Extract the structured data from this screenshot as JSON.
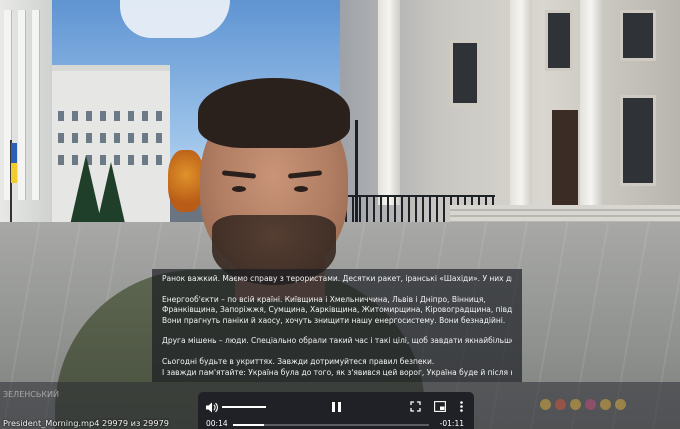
{
  "subtitles": {
    "lines": [
      "Ранок важкий. Маємо справу з терористами. Десятки ракет, іранські «Шахіди». У них дві мішені.",
      "",
      "Енергооб'єкти – по всій країні. Київщина і Хмельниччина, Львів і Дніпро, Вінниця,",
      "Франківщина, Запоріжжя, Сумщина, Харківщина, Житомирщина, Кіровоградщина, південь.",
      "Вони прагнуть паніки й хаосу, хочуть знищити нашу енергосистему. Вони безнадійні.",
      "",
      "Друга мішень – люди. Спеціально обрали такий час і такі цілі, щоб завдати якнайбільше шкоди.",
      "",
      "Сьогодні будьте в укриттях. Завжди дотримуйтеся правил безпеки.",
      "І завжди пам'ятайте: Україна була до того, як з'явився цей ворог, Україна буде й після нього...."
    ]
  },
  "background_ui": {
    "faded_label": "ЗЕЛЕНСЬКИЙ",
    "file_caption": "President_Morning.mp4 29979 из 29979"
  },
  "player": {
    "current_time": "00:14",
    "remaining_time": "-01:11",
    "progress_fraction": 0.16,
    "volume_fraction": 1.0,
    "icons": [
      "volume-icon",
      "pause-icon",
      "fullscreen-icon",
      "picture-in-picture-icon",
      "more-options-icon"
    ]
  },
  "colors": {
    "control_bar": "#1f2126",
    "subtitle_bg": "rgba(25,28,34,0.68)",
    "subtitle_text": "#f4f4f4"
  }
}
